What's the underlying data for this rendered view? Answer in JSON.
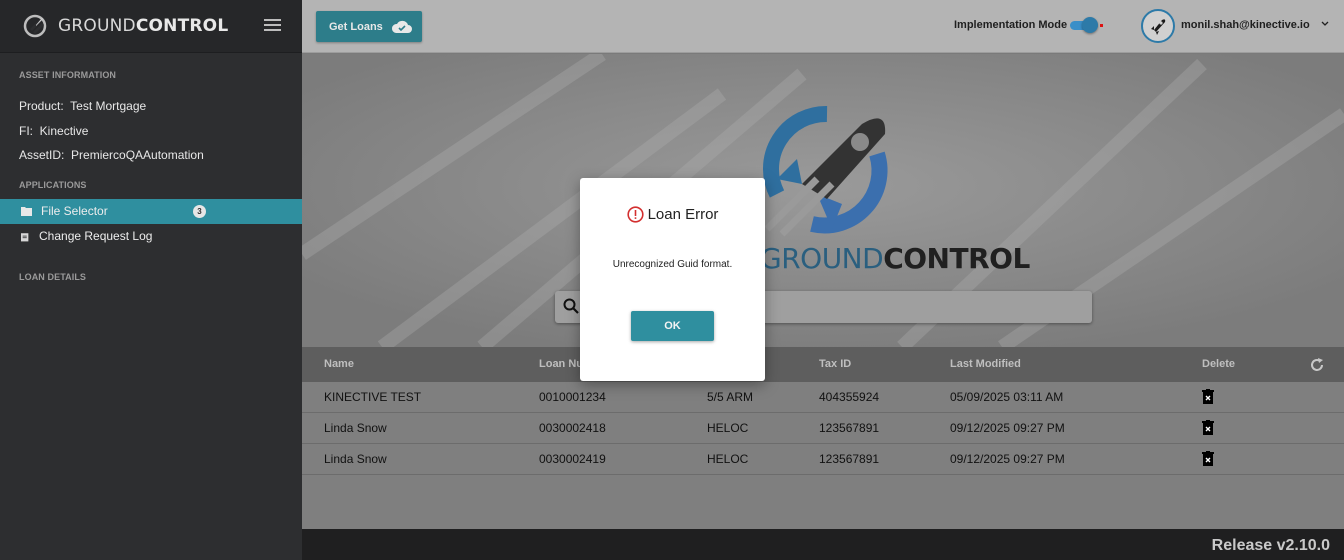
{
  "brand": {
    "light": "GROUND",
    "bold": "CONTROL"
  },
  "sidebar": {
    "asset_header": "ASSET INFORMATION",
    "product_label": "Product:",
    "product_value": "Test Mortgage",
    "fi_label": "FI:",
    "fi_value": "Kinective",
    "asset_label": "AssetID:",
    "asset_value": "PremiercoQAAutomation",
    "apps_header": "APPLICATIONS",
    "items": [
      {
        "label": "File Selector",
        "badge": "3",
        "icon": "folder-icon"
      },
      {
        "label": "Change Request Log",
        "icon": "clipboard-icon"
      }
    ],
    "loan_header": "LOAN DETAILS"
  },
  "topbar": {
    "get_loans": "Get Loans",
    "impl_mode": "Implementation Mode",
    "user_email": "monil.shah@kinective.io"
  },
  "hero": {
    "word_light": "GROUND",
    "word_bold": "CONTROL",
    "search_placeholder": ""
  },
  "table": {
    "headers": [
      "Name",
      "Loan Nu",
      "",
      "Tax ID",
      "Last Modified",
      "Delete"
    ],
    "rows": [
      [
        "KINECTIVE TEST",
        "0010001234",
        "5/5 ARM",
        "404355924",
        "05/09/2025 03:11 AM"
      ],
      [
        "Linda Snow",
        "0030002418",
        "HELOC",
        "123567891",
        "09/12/2025 09:27 PM"
      ],
      [
        "Linda Snow",
        "0030002419",
        "HELOC",
        "123567891",
        "09/12/2025 09:27 PM"
      ]
    ]
  },
  "footer": {
    "release": "Release v2.10.0"
  },
  "modal": {
    "title": "Loan Error",
    "message": "Unrecognized Guid format.",
    "ok": "OK"
  },
  "colors": {
    "accent": "#2f8f9f",
    "error": "#d32f2f",
    "sidebar": "#2d2e30"
  }
}
